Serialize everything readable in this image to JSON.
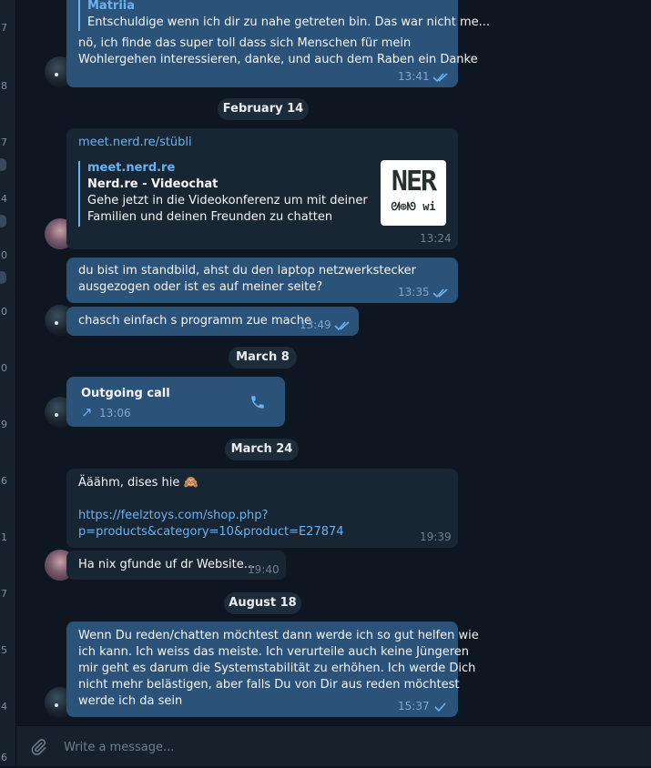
{
  "sidebar_numbers": [
    "7",
    "8",
    "7",
    "4",
    "0",
    "0",
    "0",
    "9",
    "6",
    "1",
    "7",
    "5",
    "4",
    "6"
  ],
  "messages": {
    "m1_reply_name": "Matriia",
    "m1_reply_text": "Entschuldige wenn ich dir zu nahe getreten bin. Das war nicht me...",
    "m1_line1": "nö, ich finde das super toll dass sich Menschen für mein",
    "m1_line2": "Wohlergehen interessieren, danke, und auch dem Raben ein Danke",
    "m1_time": "13:41",
    "date1": "February 14",
    "m2_link": "meet.nerd.re/stübli",
    "m2_preview_site": "meet.nerd.re",
    "m2_preview_title": "Nerd.re - Videochat",
    "m2_preview_line1": "Gehe jetzt in die Videokonferenz um mit deiner",
    "m2_preview_line2": "Familien und deinen Freunden zu chatten",
    "m2_thumb_text": "NER",
    "m2_thumb_sub": "ᘛ⊕ᘚ wi",
    "m2_time": "13:24",
    "m3_line1": "du bist im standbild, ahst du den laptop netzwerkstecker",
    "m3_line2": "ausgezogen oder ist es auf meiner seite?",
    "m3_time": "13:35",
    "m4_text": "chasch einfach s programm zue mache",
    "m4_time": "13:49",
    "date2": "March 8",
    "call_title": "Outgoing call",
    "call_arrow": "↗",
    "call_time": "13:06",
    "date3": "March 24",
    "m5_line1": "Ääähm, dises hie 🙈",
    "m5_link1": "https://feelztoys.com/shop.php?",
    "m5_link2": "p=products&category=10&product=E27874",
    "m5_time": "19:39",
    "m6_text": "Ha nix gfunde uf dr Website...",
    "m6_time": "19:40",
    "date4": "August 18",
    "m7_lines": [
      "Wenn Du reden/chatten möchtest dann werde ich so gut helfen wie",
      "ich kann. Ich weiss das meiste. Ich verurteile auch keine Jüngeren",
      "mir geht es darum die Systemstabilität zu erhöhen. Ich werde Dich",
      "nicht mehr belästigen, aber falls Du von Dir aus reden möchtest",
      "werde ich da sein"
    ],
    "m7_time": "15:37"
  },
  "composer": {
    "placeholder": "Write a message..."
  },
  "icons": {
    "attach": "paperclip-icon",
    "phone": "phone-icon",
    "read": "double-check-icon",
    "sent": "single-check-icon"
  },
  "colors": {
    "outgoing": "#2b5278",
    "incoming": "#182533",
    "background": "#0e1621",
    "accent": "#6ab3f3"
  }
}
